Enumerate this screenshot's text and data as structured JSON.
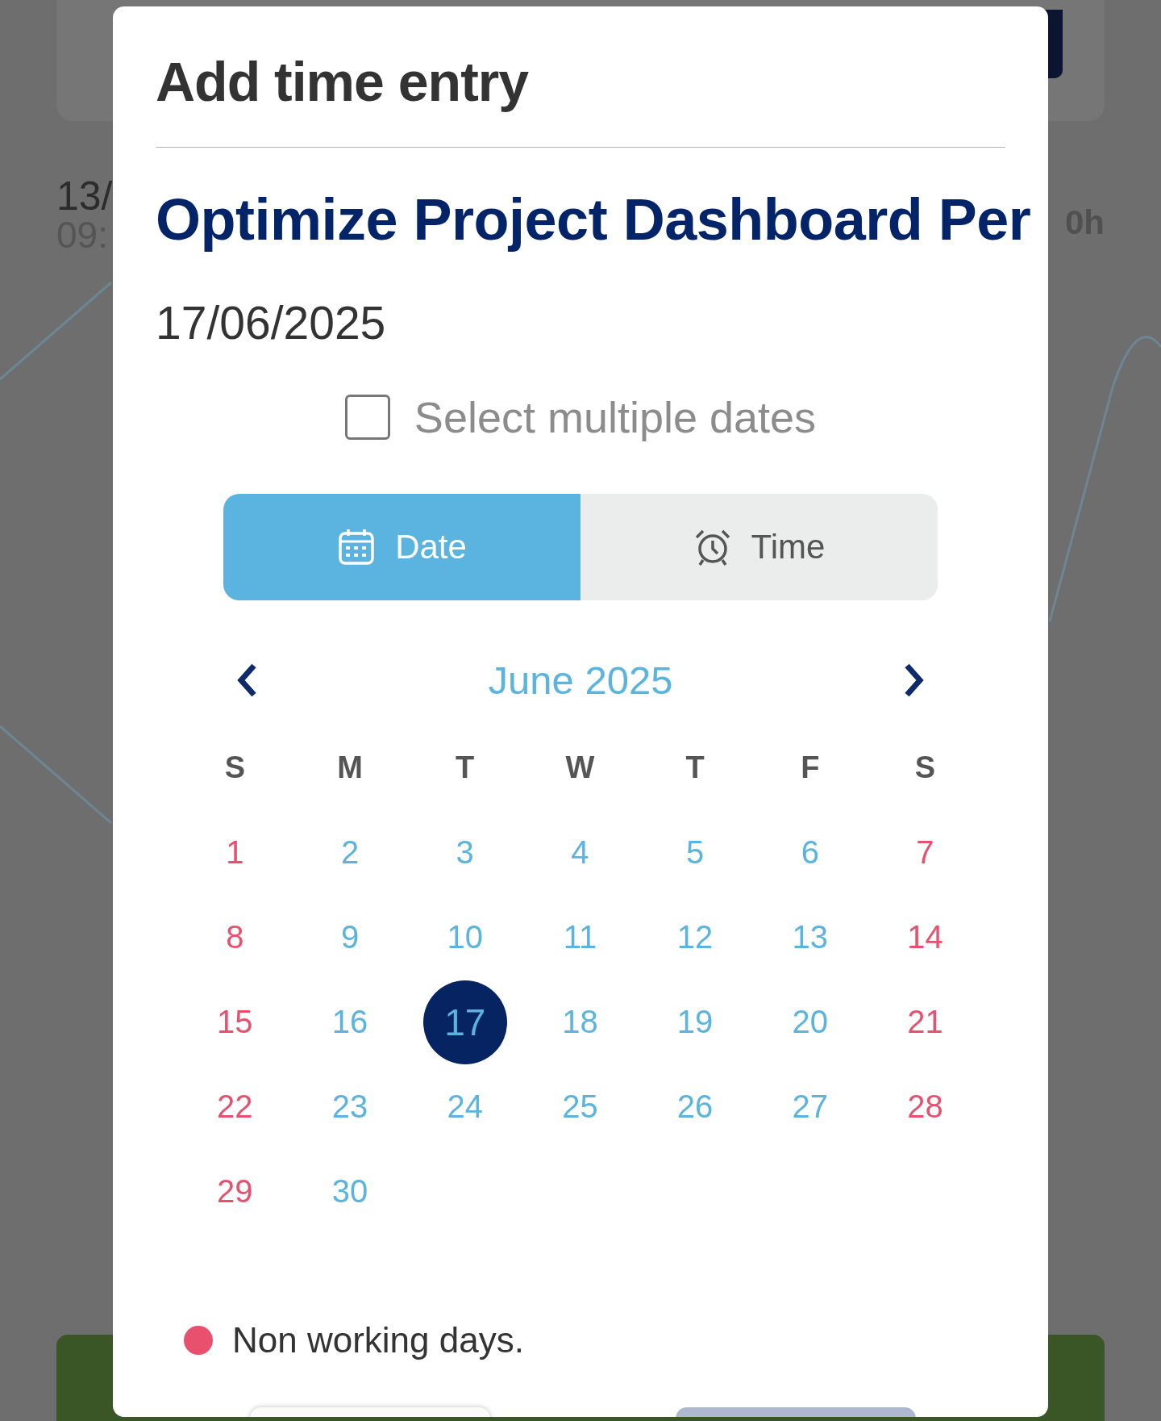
{
  "background": {
    "entry_date": "13/",
    "entry_time": "09:",
    "entry_hours": "0h"
  },
  "dialog": {
    "title": "Add time entry",
    "task_title": "Optimize Project Dashboard Per",
    "date_value": "17/06/2025",
    "multiple_dates": {
      "label": "Select multiple dates",
      "checked": false
    },
    "tabs": [
      {
        "kind": "date",
        "label": "Date",
        "selected": true
      },
      {
        "kind": "time",
        "label": "Time",
        "selected": false
      }
    ],
    "calendar": {
      "month": "June 2025",
      "weekdays": [
        "S",
        "M",
        "T",
        "W",
        "T",
        "F",
        "S"
      ],
      "weeks": [
        [
          {
            "label": "1",
            "non_working": true,
            "selected": false
          },
          {
            "label": "2",
            "non_working": false,
            "selected": false
          },
          {
            "label": "3",
            "non_working": false,
            "selected": false
          },
          {
            "label": "4",
            "non_working": false,
            "selected": false
          },
          {
            "label": "5",
            "non_working": false,
            "selected": false
          },
          {
            "label": "6",
            "non_working": false,
            "selected": false
          },
          {
            "label": "7",
            "non_working": true,
            "selected": false
          }
        ],
        [
          {
            "label": "8",
            "non_working": true,
            "selected": false
          },
          {
            "label": "9",
            "non_working": false,
            "selected": false
          },
          {
            "label": "10",
            "non_working": false,
            "selected": false
          },
          {
            "label": "11",
            "non_working": false,
            "selected": false
          },
          {
            "label": "12",
            "non_working": false,
            "selected": false
          },
          {
            "label": "13",
            "non_working": false,
            "selected": false
          },
          {
            "label": "14",
            "non_working": true,
            "selected": false
          }
        ],
        [
          {
            "label": "15",
            "non_working": true,
            "selected": false
          },
          {
            "label": "16",
            "non_working": false,
            "selected": false
          },
          {
            "label": "17",
            "non_working": false,
            "selected": true
          },
          {
            "label": "18",
            "non_working": false,
            "selected": false
          },
          {
            "label": "19",
            "non_working": false,
            "selected": false
          },
          {
            "label": "20",
            "non_working": false,
            "selected": false
          },
          {
            "label": "21",
            "non_working": true,
            "selected": false
          }
        ],
        [
          {
            "label": "22",
            "non_working": true,
            "selected": false
          },
          {
            "label": "23",
            "non_working": false,
            "selected": false
          },
          {
            "label": "24",
            "non_working": false,
            "selected": false
          },
          {
            "label": "25",
            "non_working": false,
            "selected": false
          },
          {
            "label": "26",
            "non_working": false,
            "selected": false
          },
          {
            "label": "27",
            "non_working": false,
            "selected": false
          },
          {
            "label": "28",
            "non_working": true,
            "selected": false
          }
        ],
        [
          {
            "label": "29",
            "non_working": true,
            "selected": false
          },
          {
            "label": "30",
            "non_working": false,
            "selected": false
          }
        ]
      ]
    },
    "legend": {
      "label": "Non working days.",
      "color": "#e8506e"
    }
  }
}
